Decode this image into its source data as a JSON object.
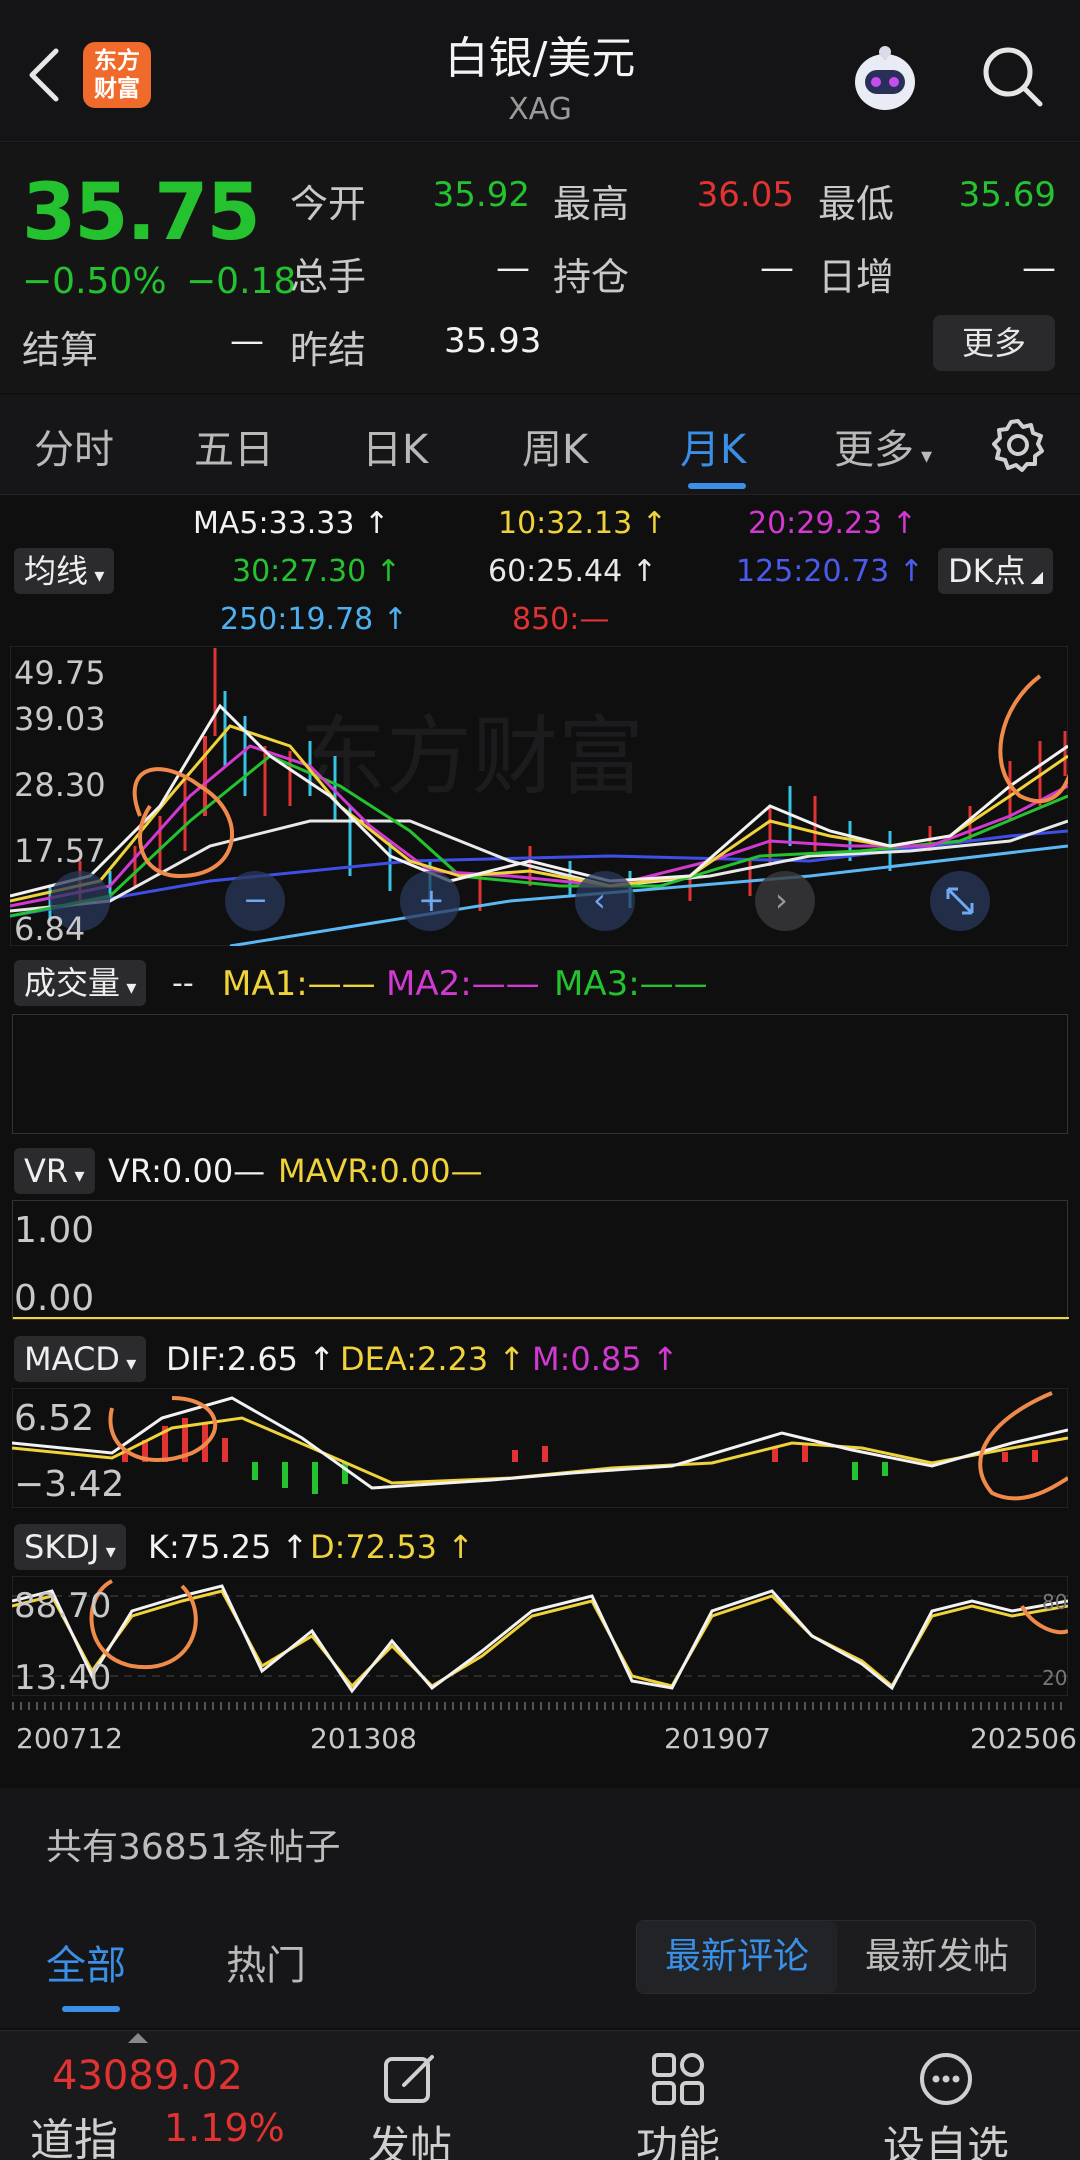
{
  "header": {
    "title": "白银/美元",
    "subtitle": "XAG",
    "logo_text": "东方\n财富",
    "icons": {
      "back": "back-arrow-icon",
      "search": "search-icon",
      "assistant": "robot-assistant-icon"
    }
  },
  "quote": {
    "price": "35.75",
    "change_pct": "−0.50%",
    "change": "−0.18",
    "labels": {
      "open": "今开",
      "high": "最高",
      "low": "最低",
      "volume": "总手",
      "position": "持仓",
      "daily_inc": "日增",
      "settle": "结算",
      "prev_settle": "昨结"
    },
    "open": "35.92",
    "high": "36.05",
    "low": "35.69",
    "volume": "—",
    "position": "—",
    "daily_inc": "—",
    "settle": "—",
    "prev_settle": "35.93",
    "more_label": "更多",
    "colors": {
      "down": "#25c22f",
      "up": "#e23333"
    }
  },
  "tabs": {
    "items": [
      "分时",
      "五日",
      "日K",
      "周K",
      "月K",
      "更多"
    ],
    "active": "月K"
  },
  "ma": {
    "dropdown": "均线",
    "dk_button": "DK点",
    "ma5": "MA5:33.33 ↑",
    "ma10": "10:32.13 ↑",
    "ma20": "20:29.23 ↑",
    "ma30": "30:27.30 ↑",
    "ma60": "60:25.44 ↑",
    "ma125": "125:20.73 ↑",
    "ma250": "250:19.78 ↑",
    "ma850": "850:—"
  },
  "price_axis": [
    "49.75",
    "39.03",
    "28.30",
    "17.57",
    "6.84"
  ],
  "watermark": "东方财富",
  "volume_panel": {
    "dropdown": "成交量",
    "dash": "--",
    "ma1": "MA1:——",
    "ma2": "MA2:——",
    "ma3": "MA3:——"
  },
  "vr_panel": {
    "dropdown": "VR",
    "vr": "VR:0.00—",
    "mavr": "MAVR:0.00—",
    "axis": [
      "1.00",
      "0.00"
    ]
  },
  "macd_panel": {
    "dropdown": "MACD",
    "dif": "DIF:2.65 ↑",
    "dea": "DEA:2.23 ↑",
    "m": "M:0.85 ↑",
    "axis": [
      "6.52",
      "−3.42"
    ]
  },
  "skdj_panel": {
    "dropdown": "SKDJ",
    "k": "K:75.25 ↑",
    "d": "D:72.53 ↑",
    "axis": [
      "88.70",
      "13.40"
    ],
    "right_axis": [
      "80",
      "20"
    ]
  },
  "dates": [
    "200712",
    "201308",
    "201907",
    "202506"
  ],
  "posts": {
    "count_text": "共有36851条帖子",
    "tabs": [
      "全部",
      "热门"
    ],
    "sort": [
      "最新评论",
      "最新发帖"
    ]
  },
  "bottom_bar": {
    "index_value": "43089.02",
    "index_label": "道指",
    "index_change": "1.19%",
    "nav": [
      "发帖",
      "功能",
      "设自选"
    ]
  }
}
